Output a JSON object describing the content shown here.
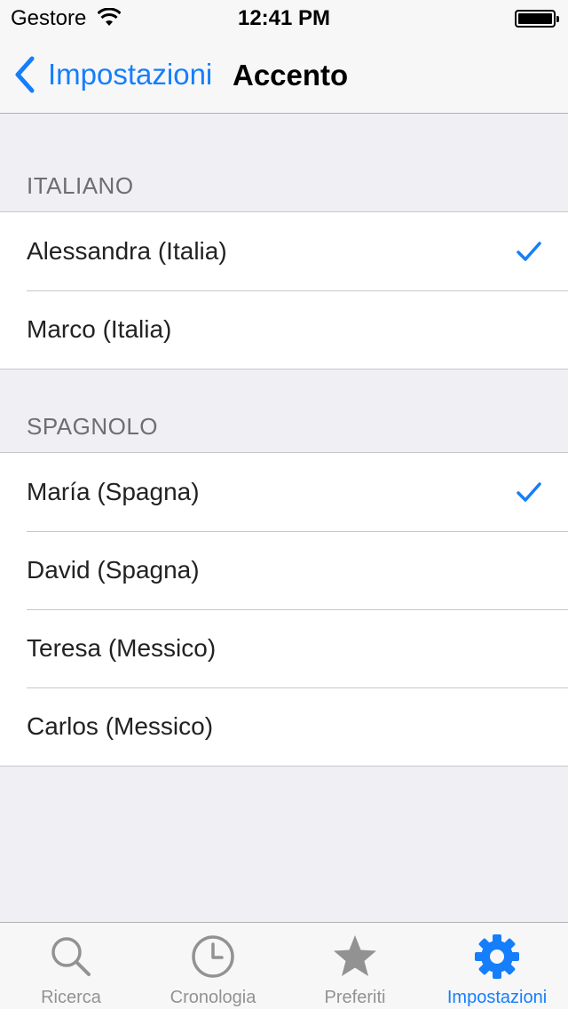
{
  "status_bar": {
    "carrier": "Gestore",
    "time": "12:41 PM"
  },
  "nav": {
    "back_label": "Impostazioni",
    "title": "Accento"
  },
  "sections": [
    {
      "header": "ITALIANO",
      "items": [
        {
          "label": "Alessandra (Italia)",
          "selected": true
        },
        {
          "label": "Marco (Italia)",
          "selected": false
        }
      ]
    },
    {
      "header": "SPAGNOLO",
      "items": [
        {
          "label": "María (Spagna)",
          "selected": true
        },
        {
          "label": "David (Spagna)",
          "selected": false
        },
        {
          "label": "Teresa (Messico)",
          "selected": false
        },
        {
          "label": "Carlos (Messico)",
          "selected": false
        }
      ]
    }
  ],
  "tabs": [
    {
      "label": "Ricerca",
      "icon": "search-icon",
      "active": false
    },
    {
      "label": "Cronologia",
      "icon": "clock-icon",
      "active": false
    },
    {
      "label": "Preferiti",
      "icon": "star-icon",
      "active": false
    },
    {
      "label": "Impostazioni",
      "icon": "gear-icon",
      "active": true
    }
  ],
  "colors": {
    "accent": "#157efb",
    "inactive_tab": "#929292",
    "background": "#efeff4"
  }
}
